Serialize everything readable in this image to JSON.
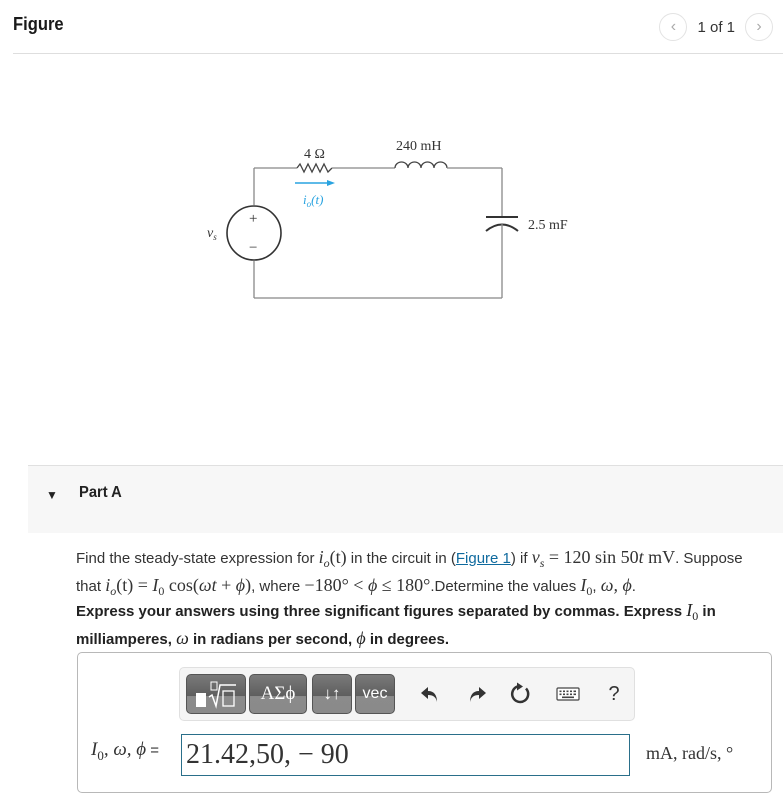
{
  "figure": {
    "title": "Figure",
    "pager_text": "1 of 1",
    "prev_icon": "chevron-left-icon",
    "next_icon": "chevron-right-icon"
  },
  "circuit": {
    "resistor_label": "4 Ω",
    "inductor_label": "240 mH",
    "capacitor_label": "2.5 mF",
    "current_label": "i",
    "current_sub": "o",
    "current_arg": "(t)",
    "source_label": "v",
    "source_sub": "s",
    "plus": "+",
    "minus": "−",
    "current_color": "#29a3e0"
  },
  "part": {
    "toggle_icon": "▼",
    "title": "Part A"
  },
  "question": {
    "t1": "Find the steady-state expression for ",
    "io": "i",
    "io_sub": "o",
    "io_arg": "(t)",
    "t2": " in the circuit in (",
    "link": "Figure 1",
    "t3": ") if ",
    "vs_expr_a": "v",
    "vs_sub": "s",
    "vs_expr_b": " = 120 sin 50",
    "vs_t": "t",
    "vs_unit": " mV",
    "t4": ". Suppose",
    "l2_t1": "that ",
    "l2_eq": " = ",
    "l2_I0": "I",
    "l2_I0sub": "0",
    "l2_cos": " cos(",
    "l2_wt": "ωt",
    "l2_plus": " + ",
    "l2_phi": "ϕ",
    "l2_close": ")",
    "l2_t2": ", where ",
    "l2_range_a": "−180° < ",
    "l2_range_b": " ≤ 180°",
    "l2_t3": ".Determine the values ",
    "l2_vars": "ω, ϕ",
    "l2_end": "."
  },
  "instructions": {
    "t1": "Express your answers using three significant figures separated by commas. Express ",
    "I0": "I",
    "I0sub": "0",
    "t2": " in milliamperes, ",
    "w": "ω",
    "t3": " in radians per second, ",
    "phi": "ϕ",
    "t4": " in degrees."
  },
  "toolbar": {
    "templates_icon": "templates-icon",
    "greek_label": "ΑΣϕ",
    "arrows_label": "↓↑",
    "vec_label": "vec",
    "undo": "undo-icon",
    "redo": "redo-icon",
    "reset": "reset-icon",
    "keyboard": "keyboard-icon",
    "help_label": "?"
  },
  "answer": {
    "label_vars": "I",
    "label_sub": "0",
    "label_rest": ", ω, ϕ",
    "label_eq": " =",
    "value": "21.42,50, − 90",
    "units": "mA, rad/s, °"
  }
}
